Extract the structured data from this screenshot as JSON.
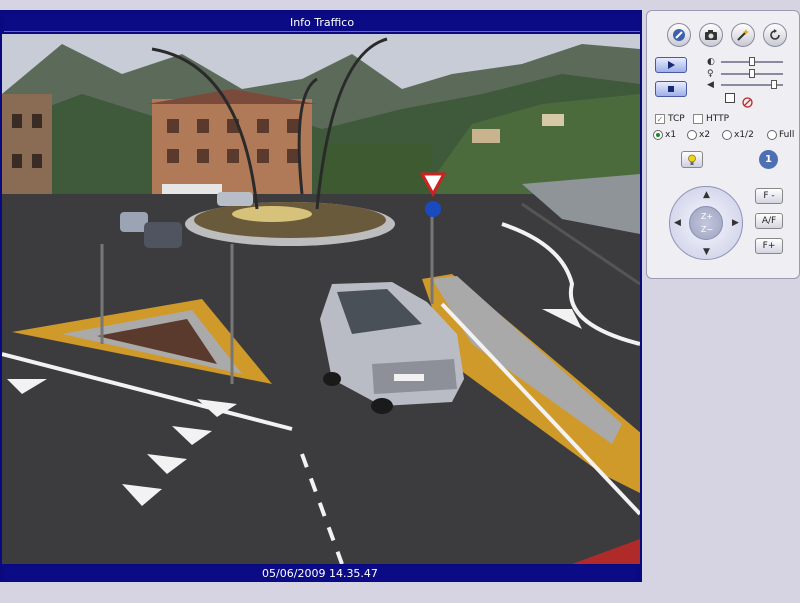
{
  "viewer": {
    "title": "Info Traffico",
    "timestamp": "05/06/2009 14.35.47"
  },
  "controls": {
    "transport": {
      "tcp_label": "TCP",
      "http_label": "HTTP",
      "tcp_checked": true,
      "http_checked": false
    },
    "scale_options": [
      {
        "label": "x1",
        "selected": true
      },
      {
        "label": "x2",
        "selected": false
      },
      {
        "label": "x1/2",
        "selected": false
      },
      {
        "label": "Full",
        "selected": false
      }
    ],
    "preset_number": "1",
    "focus_minus": "F -",
    "auto_focus": "A/F",
    "focus_plus": "F+",
    "zoom_in": "Z+",
    "zoom_out": "Z−",
    "brightness_level": 0.5,
    "contrast_level": 0.5,
    "volume_level": 0.9
  },
  "colors": {
    "frame": "#0a0a80",
    "background": "#d6d3e3",
    "panel": "#eeeef3",
    "accent": "#4f6fb3"
  },
  "icons": [
    "connect-icon",
    "snapshot-icon",
    "wand-icon",
    "refresh-icon",
    "play-icon",
    "stop-icon",
    "brightness-icon",
    "contrast-icon",
    "volume-icon",
    "mute-icon",
    "light-icon"
  ]
}
